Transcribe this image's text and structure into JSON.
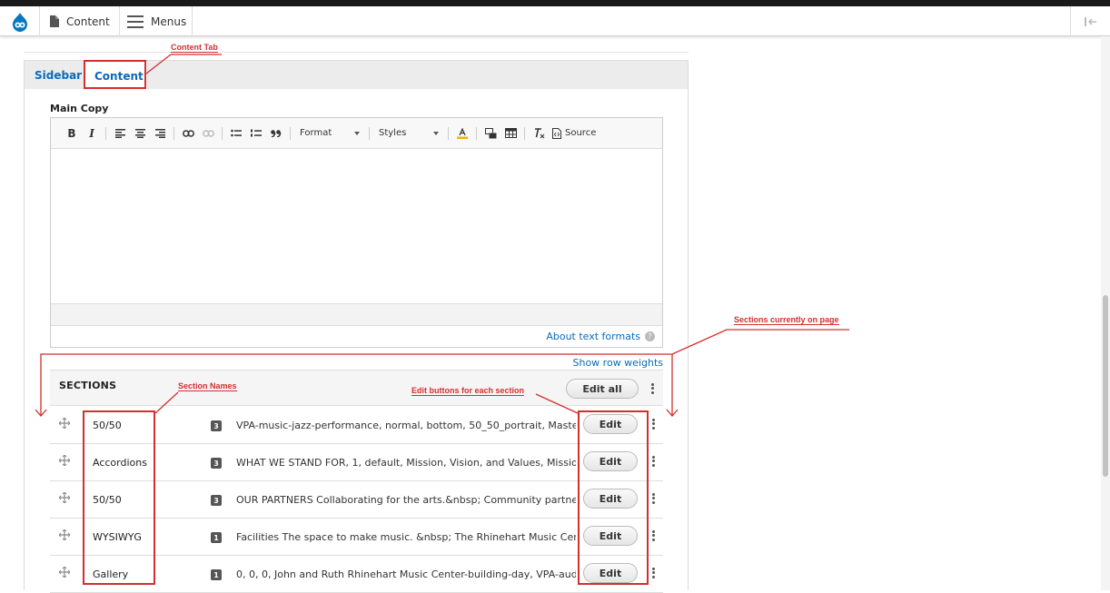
{
  "toolbar": {
    "logo_icon": "drupal-drop-icon",
    "content_label": "Content",
    "menus_label": "Menus",
    "collapse_icon": "collapse-sidebar-icon"
  },
  "tabs": [
    {
      "label": "Sidebar",
      "active": false
    },
    {
      "label": "Content",
      "active": true
    }
  ],
  "main_copy": {
    "label": "Main Copy",
    "toolbar": {
      "bold": "B",
      "italic": "I",
      "format_label": "Format",
      "styles_label": "Styles",
      "source_label": "Source"
    },
    "about_formats": "About text formats",
    "help_glyph": "?"
  },
  "sections": {
    "show_row_weights": "Show row weights",
    "title": "SECTIONS",
    "edit_all_label": "Edit all",
    "edit_label": "Edit",
    "rows": [
      {
        "name": "50/50",
        "count": "3",
        "summary": "VPA-music-jazz-performance, normal, bottom, 50_50_portrait, Master of Music in Jazz Studies"
      },
      {
        "name": "Accordions",
        "count": "3",
        "summary": "WHAT WE STAND FOR, 1, default, Mission, Vision, and Values, Mission Statement"
      },
      {
        "name": "50/50",
        "count": "3",
        "summary": "OUR PARTNERS Collaborating for the arts.&nbsp; Community partners and organizations"
      },
      {
        "name": "WYSIWYG",
        "count": "1",
        "summary": "Facilities The space to make music. &nbsp; The Rhinehart Music Center houses"
      },
      {
        "name": "Gallery",
        "count": "1",
        "summary": "0, 0, 0, John and Ruth Rhinehart Music Center-building-day, VPA-auditorium"
      }
    ]
  },
  "annotations": {
    "content_tab": "Content Tab",
    "sections_on_page": "Sections currently on page",
    "section_names": "Section Names",
    "edit_buttons": "Edit buttons for each section",
    "color": "#d32f2f"
  },
  "colors": {
    "link": "#0a6ab8",
    "drupal_blue": "#0678be"
  }
}
